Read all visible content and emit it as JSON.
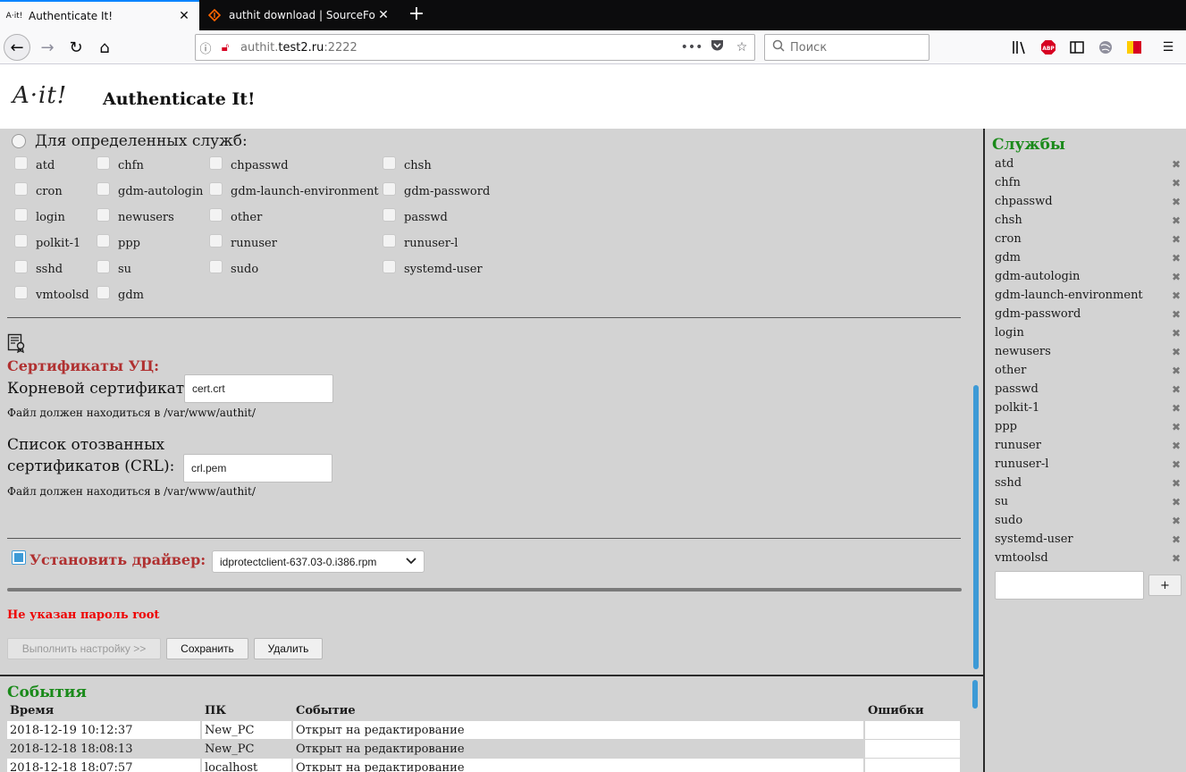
{
  "browser": {
    "tabs": [
      {
        "title": "Authenticate It!",
        "favicon": "A·it!"
      },
      {
        "title": "authit download | SourceForge"
      }
    ],
    "url_host_prefix": "authit.",
    "url_host_main": "test2.ru",
    "url_port": ":2222",
    "search_placeholder": "Поиск"
  },
  "header": {
    "logo": "A·it!",
    "title": "Authenticate It!"
  },
  "services_select": {
    "radio_label": "Для определенных служб:",
    "checkboxes": [
      "atd",
      "chfn",
      "chpasswd",
      "chsh",
      "cron",
      "gdm-autologin",
      "gdm-launch-environment",
      "gdm-password",
      "login",
      "newusers",
      "other",
      "passwd",
      "polkit-1",
      "ppp",
      "runuser",
      "runuser-l",
      "sshd",
      "su",
      "sudo",
      "systemd-user",
      "vmtoolsd",
      "gdm"
    ]
  },
  "certs": {
    "heading": "Сертификаты УЦ:",
    "root_label": "Корневой сертификат:",
    "root_value": "cert.crt",
    "root_hint": "Файл должен находиться в /var/www/authit/",
    "crl_label_1": "Список отозванных",
    "crl_label_2": "сертификатов (CRL):",
    "crl_value": "crl.pem",
    "crl_hint": "Файл должен находиться в /var/www/authit/"
  },
  "driver": {
    "label": "Установить драйвер:",
    "selected": "idprotectclient-637.03-0.i386.rpm",
    "checked": true
  },
  "status": {
    "error": "Не указан пароль root"
  },
  "actions": {
    "run_label": "Выполнить настройку >>",
    "save_label": "Сохранить",
    "delete_label": "Удалить"
  },
  "sidebar": {
    "heading": "Службы",
    "items": [
      "atd",
      "chfn",
      "chpasswd",
      "chsh",
      "cron",
      "gdm",
      "gdm-autologin",
      "gdm-launch-environment",
      "gdm-password",
      "login",
      "newusers",
      "other",
      "passwd",
      "polkit-1",
      "ppp",
      "runuser",
      "runuser-l",
      "sshd",
      "su",
      "sudo",
      "systemd-user",
      "vmtoolsd"
    ],
    "remove_glyph": "✖",
    "add_label": "+"
  },
  "events": {
    "heading": "События",
    "columns": [
      "Время",
      "ПК",
      "Событие",
      "Ошибки"
    ],
    "rows": [
      [
        "2018-12-19 10:12:37",
        "New_PC",
        "Открыт на редактирование",
        ""
      ],
      [
        "2018-12-18 18:08:13",
        "New_PC",
        "Открыт на редактирование",
        ""
      ],
      [
        "2018-12-18 18:07:57",
        "localhost",
        "Открыт на редактирование",
        ""
      ]
    ]
  },
  "colors": {
    "panel_bg": "#d3d3d3",
    "accent_blue": "#3d9ad6",
    "heading_red": "#b03030",
    "heading_green": "#1a8a1a",
    "error_red": "#ee0000"
  }
}
